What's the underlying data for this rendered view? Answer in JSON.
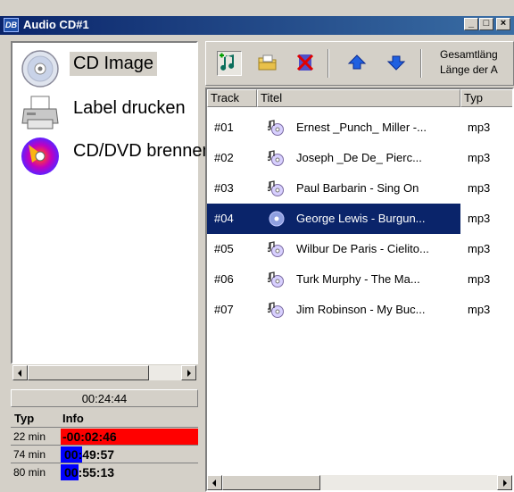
{
  "window": {
    "title": "Audio CD#1",
    "app_icon_text": "DB",
    "minimize_label": "_",
    "maximize_label": "□",
    "close_label": "×"
  },
  "nav": {
    "items": [
      {
        "label": "CD Image",
        "icon": "cd-disc-icon",
        "selected": true
      },
      {
        "label": "Label drucken",
        "icon": "printer-icon",
        "selected": false
      },
      {
        "label": "CD/DVD brennen",
        "icon": "burn-disc-icon",
        "selected": false
      }
    ]
  },
  "summary": {
    "total_time": "00:24:44",
    "header_typ": "Typ",
    "header_info": "Info",
    "rows": [
      {
        "typ": "22 min",
        "info": "-00:02:46",
        "color": "#ff0000"
      },
      {
        "typ": "74 min",
        "info": "00:49:57",
        "color": "#0000ff"
      },
      {
        "typ": "80 min",
        "info": "00:55:13",
        "color": "#0000ff"
      }
    ]
  },
  "toolbar": {
    "buttons": [
      {
        "icon": "add-track-icon",
        "pressed": true
      },
      {
        "icon": "open-folder-icon",
        "pressed": false
      },
      {
        "icon": "delete-track-icon",
        "pressed": false
      },
      {
        "icon": "move-up-icon",
        "pressed": false
      },
      {
        "icon": "move-down-icon",
        "pressed": false
      }
    ],
    "info_line1": "Gesamtläng",
    "info_line2": "Länge der A"
  },
  "tracks": {
    "columns": [
      "Track",
      "Titel",
      "Typ"
    ],
    "rows": [
      {
        "track": "#01",
        "title": "Ernest _Punch_ Miller -...",
        "type": "mp3",
        "selected": false
      },
      {
        "track": "#02",
        "title": "Joseph _De De_ Pierc...",
        "type": "mp3",
        "selected": false
      },
      {
        "track": "#03",
        "title": "Paul Barbarin - Sing On",
        "type": "mp3",
        "selected": false
      },
      {
        "track": "#04",
        "title": "George Lewis - Burgun...",
        "type": "mp3",
        "selected": true
      },
      {
        "track": "#05",
        "title": "Wilbur De Paris - Cielito...",
        "type": "mp3",
        "selected": false
      },
      {
        "track": "#06",
        "title": "Turk Murphy - The Ma...",
        "type": "mp3",
        "selected": false
      },
      {
        "track": "#07",
        "title": "Jim Robinson - My Buc...",
        "type": "mp3",
        "selected": false
      }
    ]
  },
  "colors": {
    "selection": "#0a246a",
    "titlebar_start": "#0a246a",
    "titlebar_end": "#3a6ea5",
    "face": "#d4d0c8"
  }
}
